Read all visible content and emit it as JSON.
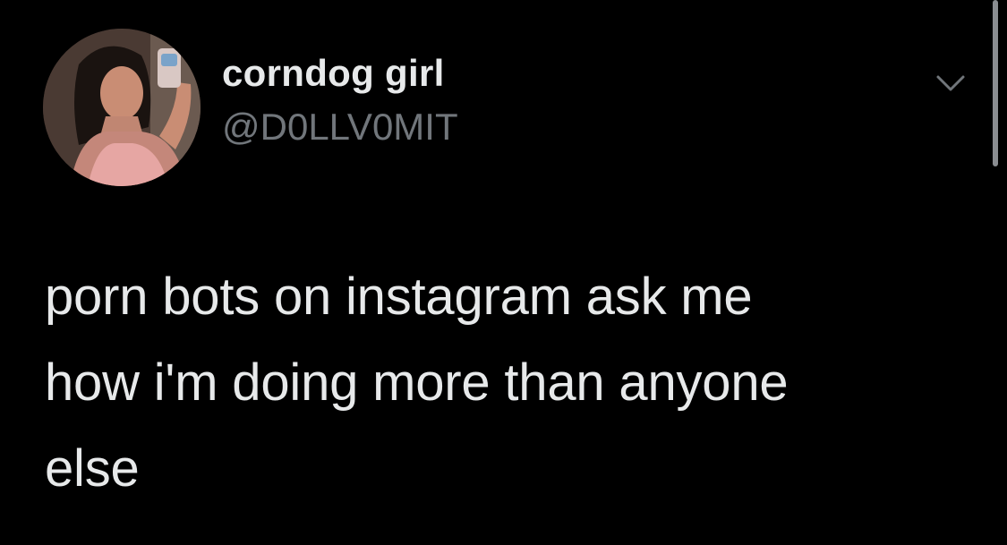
{
  "tweet": {
    "author": {
      "display_name": "corndog girl",
      "handle": "@D0LLV0MIT",
      "avatar_icon": "profile-photo"
    },
    "text": "porn bots on instagram ask me\nhow i'm doing more than anyone\nelse",
    "menu_icon": "chevron-down-icon"
  },
  "colors": {
    "background": "#000000",
    "primary_text": "#e7e9ea",
    "secondary_text": "#71767b"
  }
}
